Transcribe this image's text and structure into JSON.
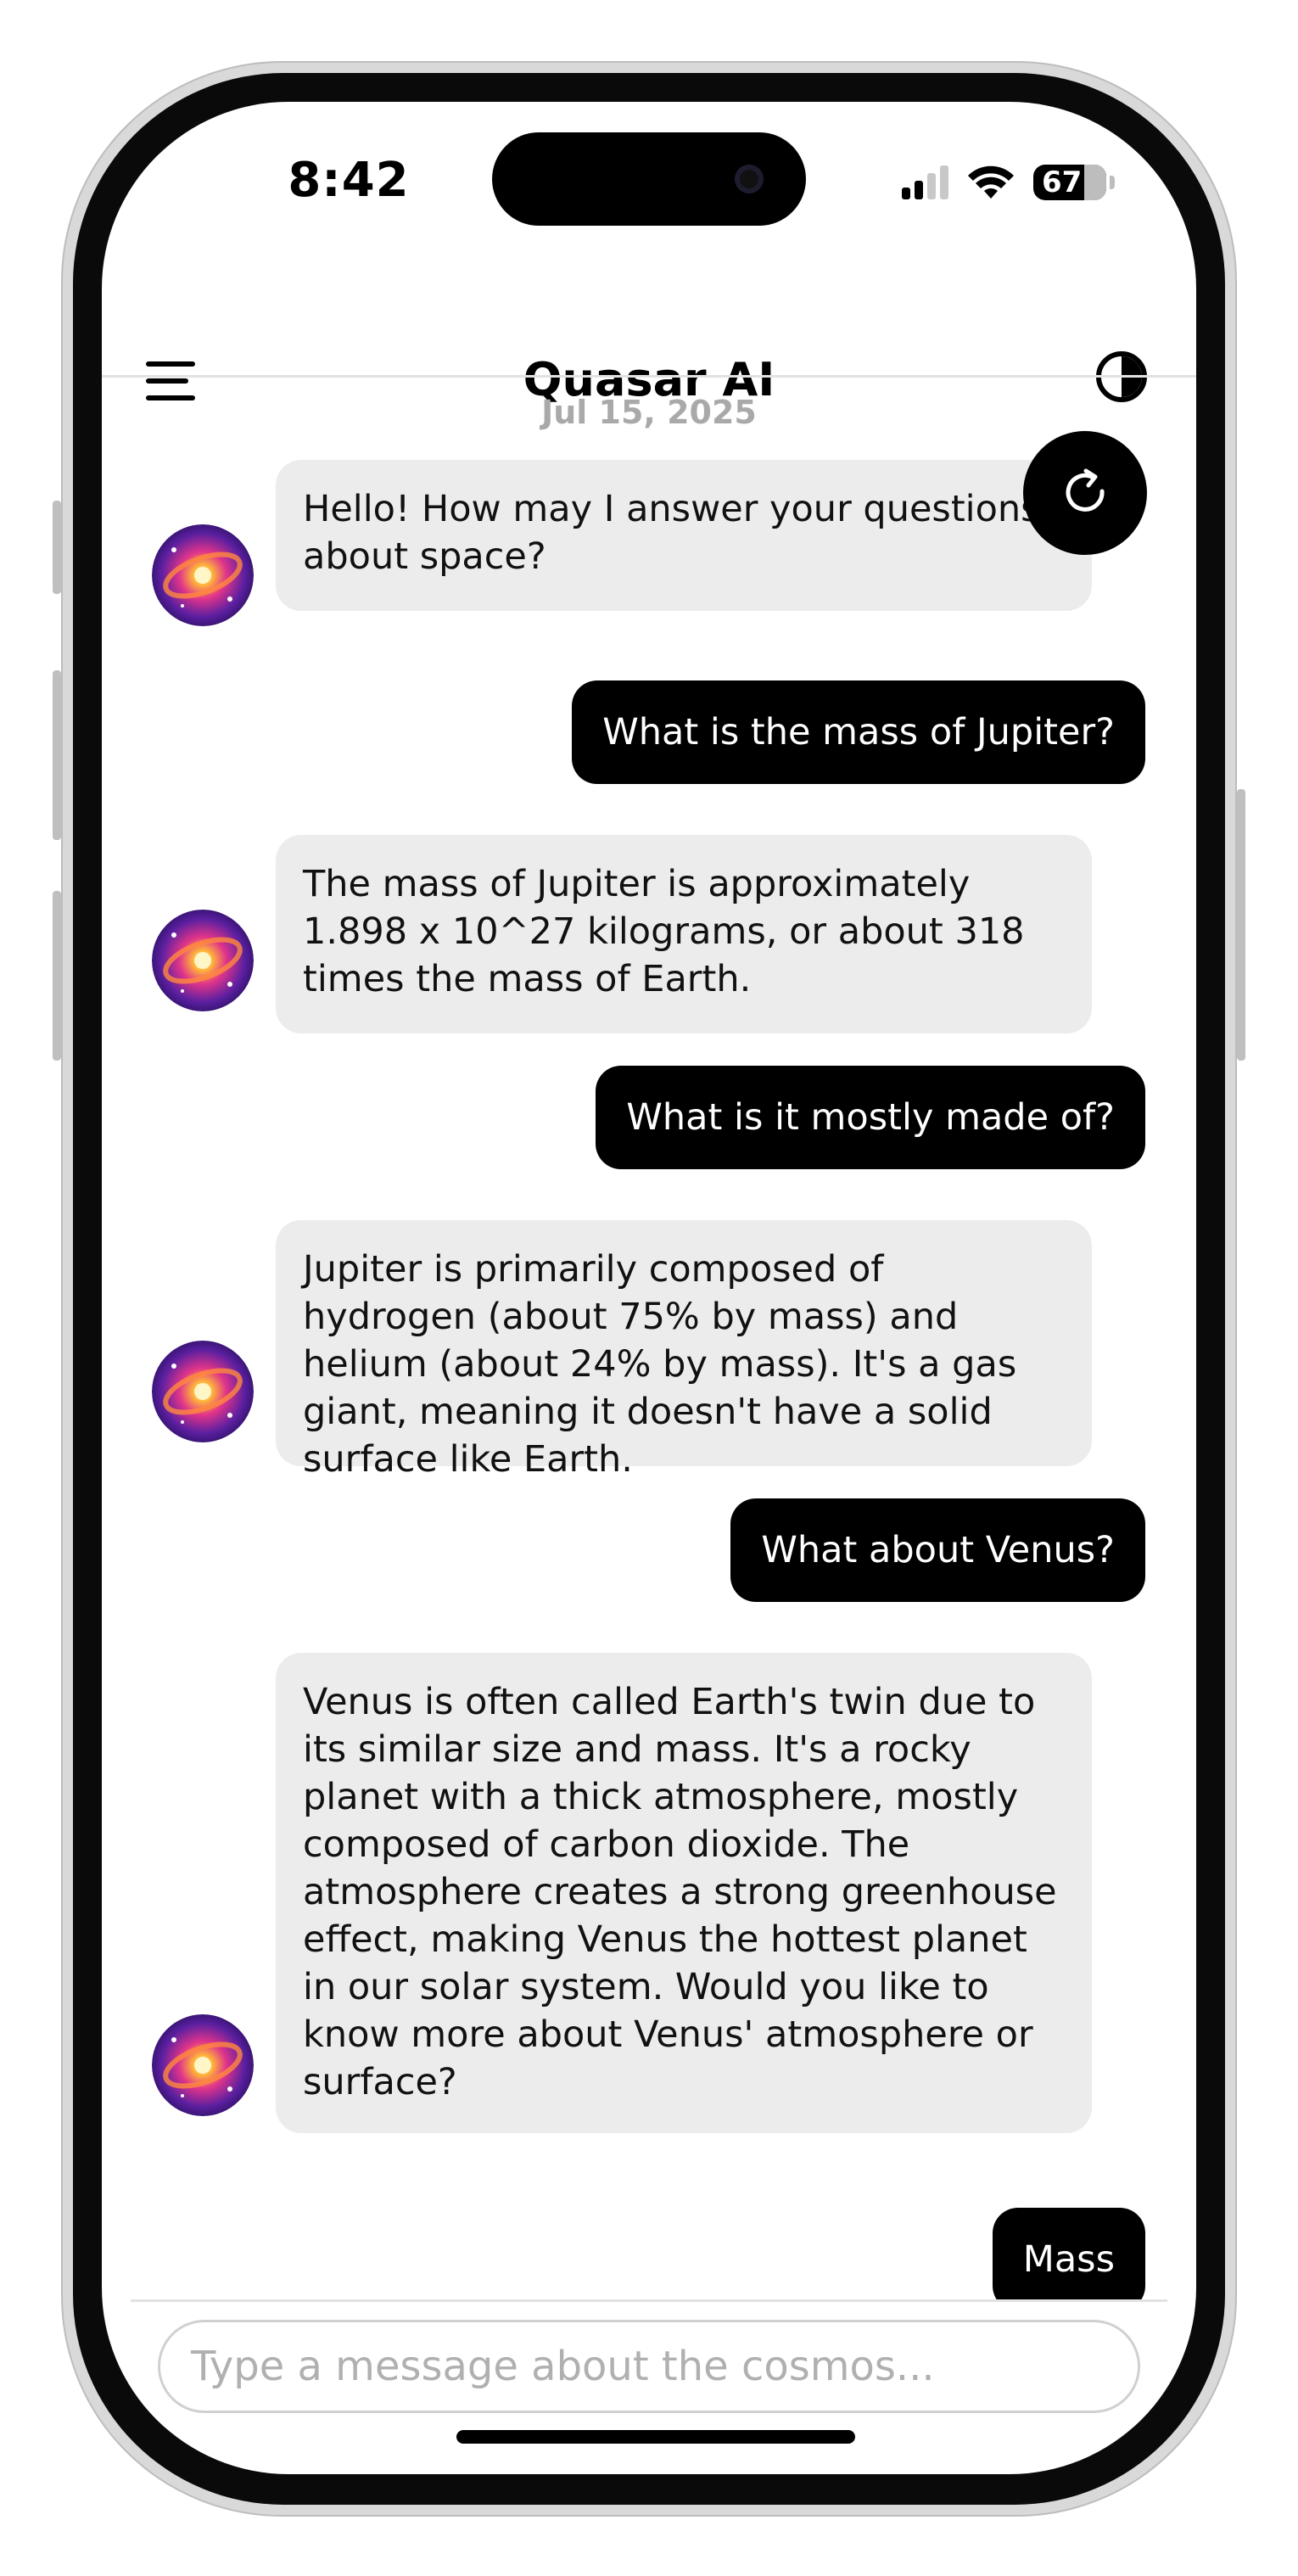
{
  "status_bar": {
    "time": "8:42",
    "battery": "67"
  },
  "header": {
    "title": "Quasar AI"
  },
  "chat": {
    "date": "Jul 15, 2025",
    "messages": [
      {
        "role": "bot",
        "text": "Hello! How may I answer your questions about space?"
      },
      {
        "role": "user",
        "text": "What is the mass of Jupiter?"
      },
      {
        "role": "bot",
        "text": "The mass of Jupiter is approximately 1.898 x 10^27 kilograms, or about 318 times the mass of Earth."
      },
      {
        "role": "user",
        "text": "What is it mostly made of?"
      },
      {
        "role": "bot",
        "text": "Jupiter is primarily composed of hydrogen (about 75% by mass) and helium (about 24% by mass). It's a gas giant, meaning it doesn't have a solid surface like Earth."
      },
      {
        "role": "user",
        "text": "What about Venus?"
      },
      {
        "role": "bot",
        "text": "Venus is often called Earth's twin due to its similar size and mass. It's a rocky planet with a thick atmosphere, mostly composed of carbon dioxide. The atmosphere creates a strong greenhouse effect, making Venus the hottest planet in our solar system. Would you like to know more about Venus' atmosphere or surface?"
      },
      {
        "role": "user",
        "text": "Mass"
      }
    ]
  },
  "composer": {
    "placeholder": "Type a message about the cosmos..."
  },
  "icons": {
    "menu": "hamburger-menu-icon",
    "theme": "contrast-toggle-icon",
    "refresh": "refresh-icon",
    "avatar": "galaxy-avatar-icon"
  }
}
